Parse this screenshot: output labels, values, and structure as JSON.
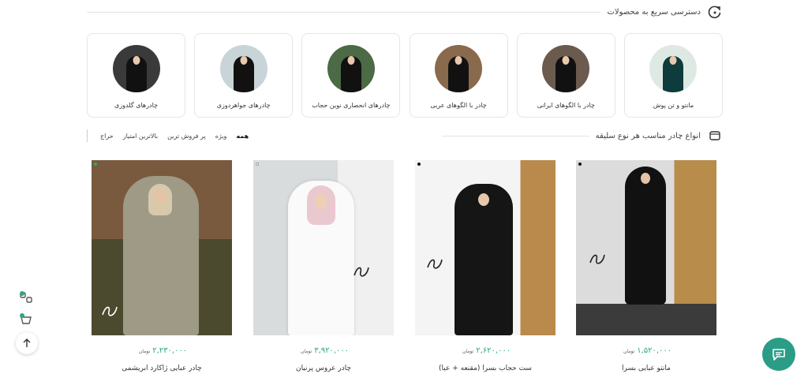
{
  "quick_access": {
    "title": "دسترسی سریع به محصولات"
  },
  "categories": [
    {
      "label": "مانتو و تن پوش"
    },
    {
      "label": "چادر با الگوهای ایرانی"
    },
    {
      "label": "چادر با الگوهای عربی"
    },
    {
      "label": "چادرهای انحصاری نوین حجاب"
    },
    {
      "label": "چادرهای جواهردوزی"
    },
    {
      "label": "چادرهای گلدوزی"
    }
  ],
  "products_section": {
    "title": "انواع چادر مناسب هر نوع سلیقه",
    "filters": [
      "همه",
      "ویژه",
      "پر فروش ترین",
      "بالاترین امتیاز",
      "حراج"
    ],
    "active_filter": "همه"
  },
  "currency": "تومان",
  "products": [
    {
      "name": "مانتو عبایی بسرا",
      "price": "۱,۵۲۰,۰۰۰"
    },
    {
      "name": "ست حجاب بسرا (مقنعه + عبا)",
      "price": "۲,۶۲۰,۰۰۰"
    },
    {
      "name": "چادر عروس پرنیان",
      "price": "۳,۹۲۰,۰۰۰"
    },
    {
      "name": "چادر عبایی ژاکارد ابریشمی",
      "price": "۲,۲۳۰,۰۰۰"
    }
  ],
  "icons": {
    "quick_access": "refresh-arrow-icon",
    "products_section": "window-icon",
    "compare": "compare-icon",
    "cart": "cart-icon",
    "top": "arrow-up-icon",
    "chat": "chat-icon"
  },
  "colors": {
    "price": "#2aa87a",
    "chat": "#2b9c86"
  }
}
